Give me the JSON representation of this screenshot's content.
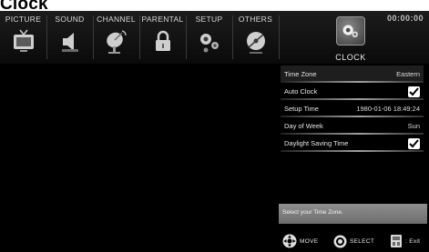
{
  "page": {
    "title": "Clock"
  },
  "menu": {
    "tabs": [
      {
        "label": "PICTURE",
        "icon": "tv-icon"
      },
      {
        "label": "SOUND",
        "icon": "speaker-icon"
      },
      {
        "label": "CHANNEL",
        "icon": "satellite-dish-icon"
      },
      {
        "label": "PARENTAL",
        "icon": "lock-icon"
      },
      {
        "label": "SETUP",
        "icon": "gears-icon"
      },
      {
        "label": "OTHERS",
        "icon": "disc-icon"
      }
    ],
    "active": {
      "label": "CLOCK",
      "icon": "clock-gear-icon"
    },
    "time": "00:00:00"
  },
  "settings": [
    {
      "label": "Time Zone",
      "value": "Eastern",
      "type": "text",
      "selected": true
    },
    {
      "label": "Auto Clock",
      "value": "checked",
      "type": "checkbox"
    },
    {
      "label": "Setup Time",
      "value": "1980-01-06 18:49:24",
      "type": "text"
    },
    {
      "label": "Day of Week",
      "value": "Sun",
      "type": "text"
    },
    {
      "label": "Daylight Saving Time",
      "value": "checked",
      "type": "checkbox"
    }
  ],
  "help": {
    "text": "Select your Time Zone."
  },
  "hints": {
    "move": "MOVE",
    "select": "SELECT",
    "exit": ": Exit"
  },
  "colors": {
    "background": "#000000",
    "highlight": "#7d7d7d",
    "text": "#e6e6e6"
  }
}
